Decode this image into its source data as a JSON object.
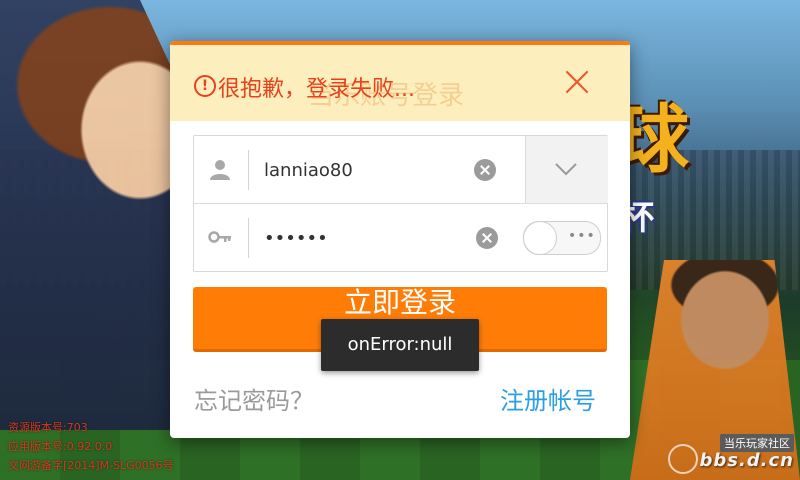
{
  "background": {
    "logo_main": "球",
    "logo_sub": "杯",
    "version_lines": [
      "资源版本号:703",
      "应用版本号:0.92.0.0",
      "文网游备字[2014]M-SLG0056号"
    ],
    "watermark_tag": "当乐玩家社区",
    "watermark_url": "bbs.d.cn"
  },
  "dialog": {
    "behind_title": "当乐账号登录",
    "error_icon": "!",
    "error_text": "很抱歉，登录失败...",
    "username": {
      "value": "lanniao80",
      "icon": "user-icon"
    },
    "password": {
      "value": "••••••",
      "icon": "key-icon"
    },
    "toggle_dots": "•••",
    "login_label": "立即登录",
    "forgot_label": "忘记密码？",
    "register_label": "注册帐号"
  },
  "toast": {
    "text": "onError:null"
  },
  "colors": {
    "accent": "#ff7d07",
    "error": "#e8411c",
    "link": "#2b9fe0",
    "banner_bg": "#fcefbd"
  }
}
